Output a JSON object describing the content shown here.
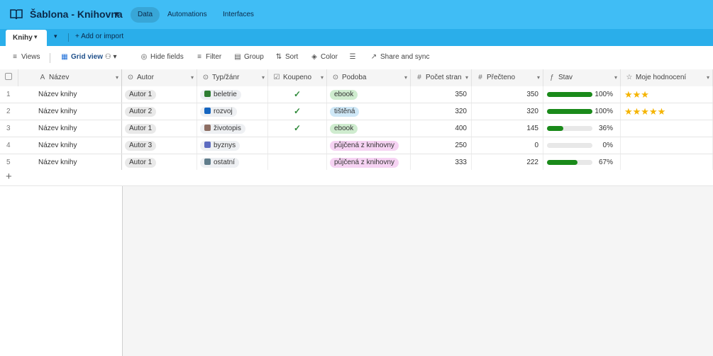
{
  "app": {
    "base_title": "Šablona - Knihovna",
    "nav": [
      "Data",
      "Automations",
      "Interfaces"
    ]
  },
  "tabs": {
    "active": "Knihy",
    "add_label": "Add or import"
  },
  "toolbar": {
    "views": "Views",
    "grid_view": "Grid view",
    "hide_fields": "Hide fields",
    "filter": "Filter",
    "group": "Group",
    "sort": "Sort",
    "color": "Color",
    "share": "Share and sync"
  },
  "columns": [
    "Název",
    "Autor",
    "Typ/žánr",
    "Koupeno",
    "Podoba",
    "Počet stran",
    "Přečteno",
    "Stav",
    "Moje hodnocení"
  ],
  "rows": [
    {
      "n": "1",
      "nazev": "Název knihy",
      "autor": "Autor 1",
      "typ": "beletrie",
      "typ_color": "#2e7d32",
      "koupeno": "✓",
      "podoba": "ebook",
      "podoba_color": "#cfeccf",
      "stran": "350",
      "precteno": "350",
      "stav": 1.0,
      "stav_label": "100%",
      "hodnoceni": "★★★"
    },
    {
      "n": "2",
      "nazev": "Název knihy",
      "autor": "Autor 2",
      "typ": "rozvoj",
      "typ_color": "#1565c0",
      "koupeno": "✓",
      "podoba": "tištěná",
      "podoba_color": "#cfe8f7",
      "stran": "320",
      "precteno": "320",
      "stav": 1.0,
      "stav_label": "100%",
      "hodnoceni": "★★★★★"
    },
    {
      "n": "3",
      "nazev": "Název knihy",
      "autor": "Autor 1",
      "typ": "životopis",
      "typ_color": "#8d6e63",
      "koupeno": "✓",
      "podoba": "ebook",
      "podoba_color": "#cfeccf",
      "stran": "400",
      "precteno": "145",
      "stav": 0.36,
      "stav_label": "36%",
      "hodnoceni": ""
    },
    {
      "n": "4",
      "nazev": "Název knihy",
      "autor": "Autor 3",
      "typ": "byznys",
      "typ_color": "#5c6bc0",
      "koupeno": "",
      "podoba": "půjčená z knihovny",
      "podoba_color": "#f6d3f3",
      "stran": "250",
      "precteno": "0",
      "stav": 0.0,
      "stav_label": "0%",
      "hodnoceni": ""
    },
    {
      "n": "5",
      "nazev": "Název knihy",
      "autor": "Autor 1",
      "typ": "ostatní",
      "typ_color": "#607d8b",
      "koupeno": "",
      "podoba": "půjčená z knihovny",
      "podoba_color": "#f6d3f3",
      "stran": "333",
      "precteno": "222",
      "stav": 0.67,
      "stav_label": "67%",
      "hodnoceni": ""
    }
  ],
  "add_row": "+"
}
